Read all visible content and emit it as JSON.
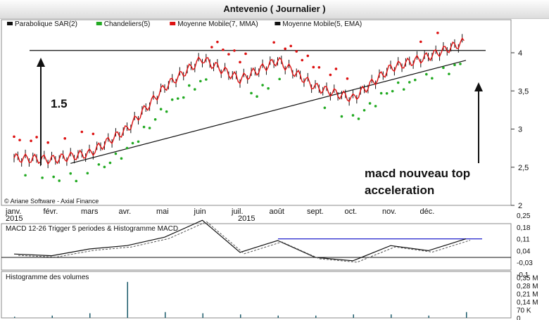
{
  "header": {
    "title": "Antevenio  ( Journalier )"
  },
  "legend": [
    {
      "label": "Parabolique SAR(2)",
      "color": "#111111"
    },
    {
      "label": "Chandeliers(5)",
      "color": "#22aa22"
    },
    {
      "label": "Moyenne Mobile(7, MMA)",
      "color": "#dd1111"
    },
    {
      "label": "Moyenne Mobile(5, EMA)",
      "color": "#111111"
    }
  ],
  "copyright": "© Ariane Software - Axial Finance",
  "annotations": {
    "left_label": "1.5",
    "right_label_line1": "macd nouveau top",
    "right_label_line2": "acceleration"
  },
  "macd_panel": {
    "label": "MACD 12-26   Trigger 5 periodes & Histogramme MACD",
    "ticks": [
      "0,25",
      "0,18",
      "0,11",
      "0,04",
      "-0,03",
      "-0,1"
    ]
  },
  "volume_panel": {
    "label": "Histogramme des volumes",
    "ticks": [
      "0,35 M",
      "0,28 M",
      "0,21 M",
      "0,14 M",
      "70 K",
      "0"
    ]
  },
  "colors": {
    "sar": "#dd1111",
    "chandelier": "#22aa22",
    "mma": "#dd1111",
    "ema": "#111111",
    "signal_line": "#2222cc"
  },
  "chart_data": {
    "type": "line",
    "y_ticks": [
      "4",
      "3,5",
      "3",
      "2,5",
      "2"
    ],
    "x_labels": [
      "janv.",
      "févr.",
      "mars",
      "avr.",
      "mai",
      "juin",
      "juil.",
      "août",
      "sept.",
      "oct.",
      "nov.",
      "déc."
    ],
    "x_year_labels": [
      "2015",
      "2015"
    ],
    "ylim": [
      2,
      4.5
    ],
    "months": [
      1,
      2,
      3,
      4,
      5,
      6,
      7,
      8,
      9,
      10,
      11,
      12
    ],
    "close": [
      2.62,
      2.6,
      2.68,
      3.0,
      3.55,
      3.92,
      3.65,
      3.9,
      3.55,
      3.4,
      3.8,
      3.95,
      4.15
    ],
    "resistance": 4.03,
    "support_start": [
      2.5,
      2.55
    ],
    "support_end": [
      13.0,
      3.9
    ],
    "macd_values": [
      0.02,
      0.01,
      0.05,
      0.07,
      0.12,
      0.22,
      0.03,
      0.1,
      0.0,
      -0.02,
      0.07,
      0.04,
      0.11
    ],
    "volume_values_m": [
      0.01,
      0.02,
      0.04,
      0.31,
      0.05,
      0.04,
      0.03,
      0.02,
      0.02,
      0.03,
      0.03,
      0.02,
      0.05
    ]
  }
}
